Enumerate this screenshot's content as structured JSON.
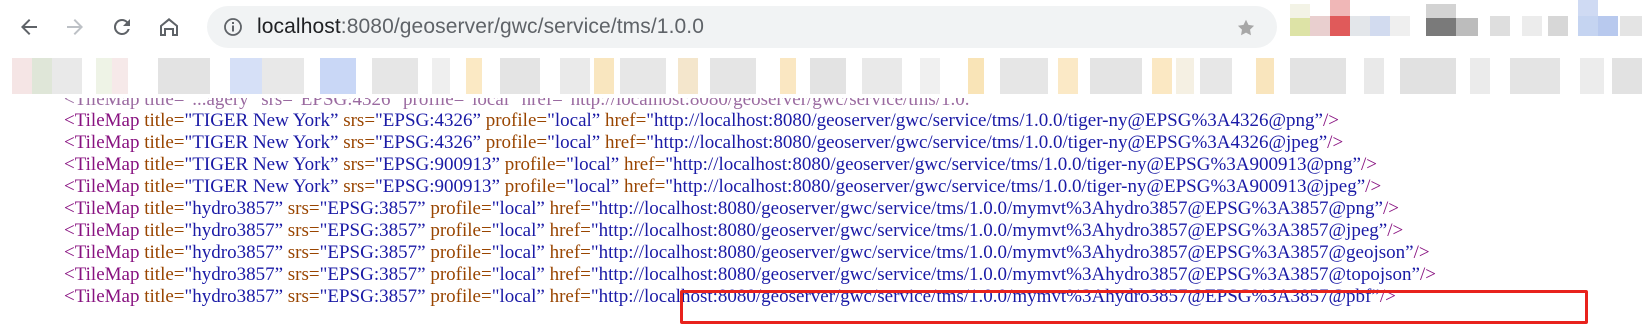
{
  "browser": {
    "url_host": "localhost",
    "url_rest": ":8080/geoserver/gwc/service/tms/1.0.0",
    "nav": [
      "back-icon",
      "forward-icon",
      "reload-icon",
      "home-icon"
    ],
    "info_icon": "info-icon",
    "star_icon": "bookmark-star-icon"
  },
  "xml": {
    "partial_line": "<TileMap title=\"...agery\" srs=\"EPSG:4326\" profile=\"local\" href=\"http://localhost:8080/geoserver/gwc/service/tms/1.0.",
    "lines": [
      {
        "title": "TIGER New York",
        "srs": "EPSG:4326",
        "profile": "local",
        "href": "http://localhost:8080/geoserver/gwc/service/tms/1.0.0/tiger-ny@EPSG%3A4326@png"
      },
      {
        "title": "TIGER New York",
        "srs": "EPSG:4326",
        "profile": "local",
        "href": "http://localhost:8080/geoserver/gwc/service/tms/1.0.0/tiger-ny@EPSG%3A4326@jpeg"
      },
      {
        "title": "TIGER New York",
        "srs": "EPSG:900913",
        "profile": "local",
        "href": "http://localhost:8080/geoserver/gwc/service/tms/1.0.0/tiger-ny@EPSG%3A900913@png"
      },
      {
        "title": "TIGER New York",
        "srs": "EPSG:900913",
        "profile": "local",
        "href": "http://localhost:8080/geoserver/gwc/service/tms/1.0.0/tiger-ny@EPSG%3A900913@jpeg"
      },
      {
        "title": "hydro3857",
        "srs": "EPSG:3857",
        "profile": "local",
        "href": "http://localhost:8080/geoserver/gwc/service/tms/1.0.0/mymvt%3Ahydro3857@EPSG%3A3857@png"
      },
      {
        "title": "hydro3857",
        "srs": "EPSG:3857",
        "profile": "local",
        "href": "http://localhost:8080/geoserver/gwc/service/tms/1.0.0/mymvt%3Ahydro3857@EPSG%3A3857@jpeg"
      },
      {
        "title": "hydro3857",
        "srs": "EPSG:3857",
        "profile": "local",
        "href": "http://localhost:8080/geoserver/gwc/service/tms/1.0.0/mymvt%3Ahydro3857@EPSG%3A3857@geojson"
      },
      {
        "title": "hydro3857",
        "srs": "EPSG:3857",
        "profile": "local",
        "href": "http://localhost:8080/geoserver/gwc/service/tms/1.0.0/mymvt%3Ahydro3857@EPSG%3A3857@topojson"
      },
      {
        "title": "hydro3857",
        "srs": "EPSG:3857",
        "profile": "local",
        "href": "http://localhost:8080/geoserver/gwc/service/tms/1.0.0/mymvt%3Ahydro3857@EPSG%3A3857@pbf"
      }
    ],
    "highlight_color": "#e8221c"
  },
  "colors": {
    "tag": "#881280",
    "attr": "#994500",
    "value": "#1a1aa6",
    "omnibox_bg": "#f1f3f4"
  }
}
